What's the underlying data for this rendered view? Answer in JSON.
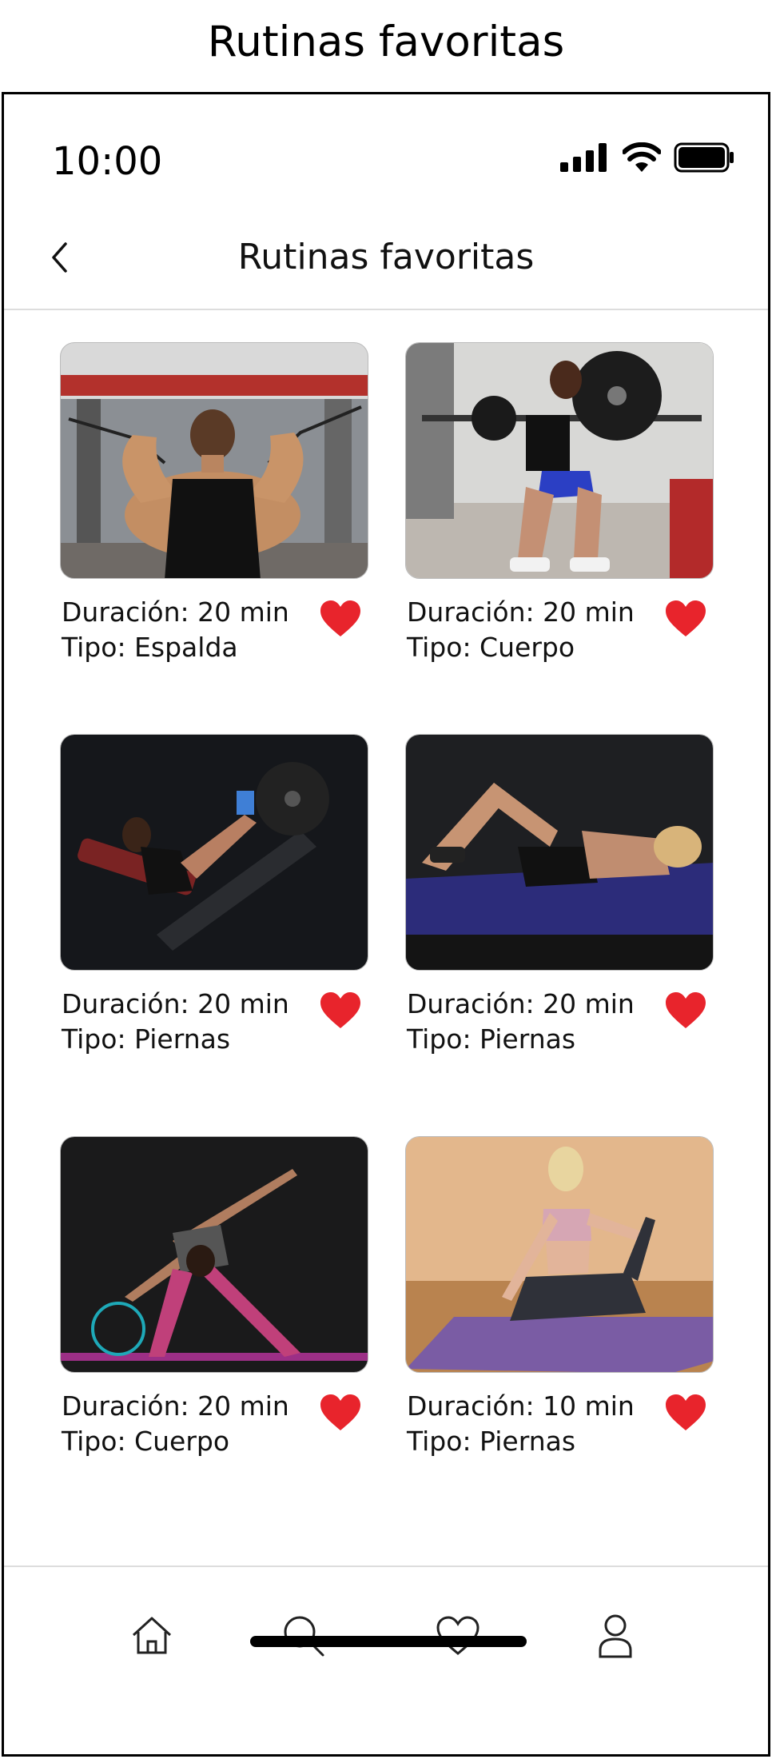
{
  "page_title": "Rutinas favoritas",
  "status_bar": {
    "time": "10:00"
  },
  "header": {
    "title": "Rutinas favoritas",
    "back_icon": "chevron-left-icon"
  },
  "routines": [
    {
      "duration": "Duración: 20 min",
      "type": "Tipo: Espalda",
      "image": "man-back-cable-workout-photo",
      "favorite": true
    },
    {
      "duration": "Duración: 20 min",
      "type": "Tipo: Cuerpo",
      "image": "woman-barbell-squat-photo",
      "favorite": true
    },
    {
      "duration": "Duración: 20 min",
      "type": "Tipo: Piernas",
      "image": "woman-leg-press-photo",
      "favorite": true
    },
    {
      "duration": "Duración: 20 min",
      "type": "Tipo: Piernas",
      "image": "woman-crunch-on-mat-photo",
      "favorite": true
    },
    {
      "duration": "Duración: 20 min",
      "type": "Tipo: Cuerpo",
      "image": "woman-triangle-pose-photo",
      "favorite": true
    },
    {
      "duration": "Duración: 10 min",
      "type": "Tipo: Piernas",
      "image": "woman-yoga-stretch-photo",
      "favorite": true
    }
  ],
  "tab_bar": {
    "items": [
      "home-icon",
      "search-icon",
      "heart-icon",
      "user-icon"
    ]
  },
  "colors": {
    "heart": "#e8242c",
    "divider": "#dddddd",
    "text": "#111111"
  }
}
